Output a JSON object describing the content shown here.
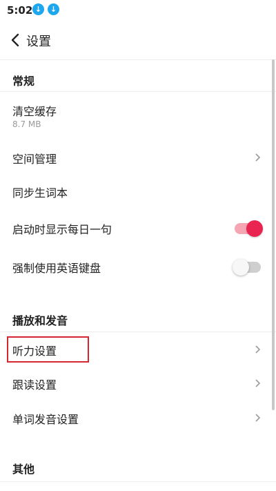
{
  "status_bar": {
    "time": "5:02",
    "icons": [
      "download-icon",
      "download-icon"
    ]
  },
  "toolbar": {
    "title": "设置",
    "back_icon": "chevron-left-icon"
  },
  "sections": {
    "general": {
      "header": "常规",
      "clear_cache": {
        "label": "清空缓存",
        "size": "8.7 MB"
      },
      "space_management": {
        "label": "空间管理"
      },
      "sync_vocab": {
        "label": "同步生词本"
      },
      "daily_sentence": {
        "label": "启动时显示每日一句",
        "enabled": true
      },
      "english_keyboard": {
        "label": "强制使用英语键盘",
        "enabled": false
      }
    },
    "playback": {
      "header": "播放和发音",
      "listening": {
        "label": "听力设置"
      },
      "shadowing": {
        "label": "跟读设置"
      },
      "word_pronunciation": {
        "label": "单词发音设置"
      }
    },
    "other": {
      "header": "其他"
    }
  },
  "colors": {
    "accent": "#ea2451",
    "accent_track": "#f6a6b3",
    "highlight": "#d3262e",
    "download_badge": "#1da7ee"
  }
}
